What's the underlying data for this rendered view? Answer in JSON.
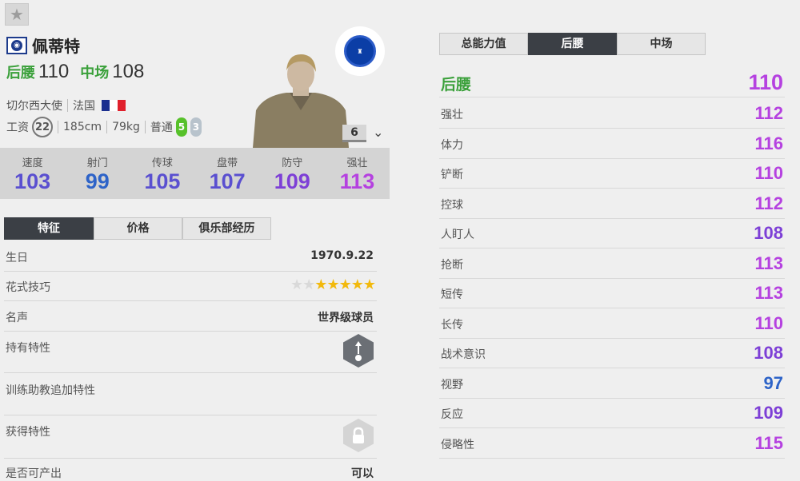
{
  "player": {
    "name": "佩蒂特",
    "season_icon": "season-badge-icon",
    "positions": [
      {
        "label": "后腰",
        "value": "110"
      },
      {
        "label": "中场",
        "value": "108"
      }
    ],
    "club": "切尔西大使",
    "nation": "法国",
    "wage_label": "工资",
    "wage": "22",
    "height": "185cm",
    "weight": "79kg",
    "body_type": "普通",
    "left_foot": "5",
    "right_foot": "3",
    "level": "6"
  },
  "colors": {
    "green": "#3aa03a",
    "blue": "#2d63c8",
    "blue_violet": "#5a4fd0",
    "violet": "#7d3fd6",
    "purple": "#b541e0",
    "tab_active": "#3b3f45"
  },
  "stats": [
    {
      "label": "速度",
      "value": "103",
      "color": "#5a4fd0"
    },
    {
      "label": "射门",
      "value": "99",
      "color": "#2d63c8"
    },
    {
      "label": "传球",
      "value": "105",
      "color": "#5a4fd0"
    },
    {
      "label": "盘带",
      "value": "107",
      "color": "#5a4fd0"
    },
    {
      "label": "防守",
      "value": "109",
      "color": "#7d3fd6"
    },
    {
      "label": "强壮",
      "value": "113",
      "color": "#b541e0"
    }
  ],
  "left_tabs": [
    "特征",
    "价格",
    "俱乐部经历"
  ],
  "details": {
    "birthday_label": "生日",
    "birthday": "1970.9.22",
    "skill_label": "花式技巧",
    "skill_stars": 5,
    "skill_total": 7,
    "fame_label": "名声",
    "fame": "世界级球员",
    "traits_label": "持有特性",
    "trait_icon": "trait-shot-icon",
    "training_label": "训练助教追加特性",
    "acquire_label": "获得特性",
    "acquire_icon": "lock-icon",
    "produce_label": "是否可产出",
    "produce": "可以"
  },
  "right_tabs": [
    "总能力值",
    "后腰",
    "中场"
  ],
  "attributes_head": {
    "label": "后腰",
    "value": "110",
    "color": "#b541e0"
  },
  "attributes": [
    {
      "label": "强壮",
      "value": "112",
      "color": "#b541e0"
    },
    {
      "label": "体力",
      "value": "116",
      "color": "#b541e0"
    },
    {
      "label": "铲断",
      "value": "110",
      "color": "#b541e0"
    },
    {
      "label": "控球",
      "value": "112",
      "color": "#b541e0"
    },
    {
      "label": "人盯人",
      "value": "108",
      "color": "#7d3fd6"
    },
    {
      "label": "抢断",
      "value": "113",
      "color": "#b541e0"
    },
    {
      "label": "短传",
      "value": "113",
      "color": "#b541e0"
    },
    {
      "label": "长传",
      "value": "110",
      "color": "#b541e0"
    },
    {
      "label": "战术意识",
      "value": "108",
      "color": "#7d3fd6"
    },
    {
      "label": "视野",
      "value": "97",
      "color": "#2d63c8"
    },
    {
      "label": "反应",
      "value": "109",
      "color": "#7d3fd6"
    },
    {
      "label": "侵略性",
      "value": "115",
      "color": "#b541e0"
    }
  ]
}
